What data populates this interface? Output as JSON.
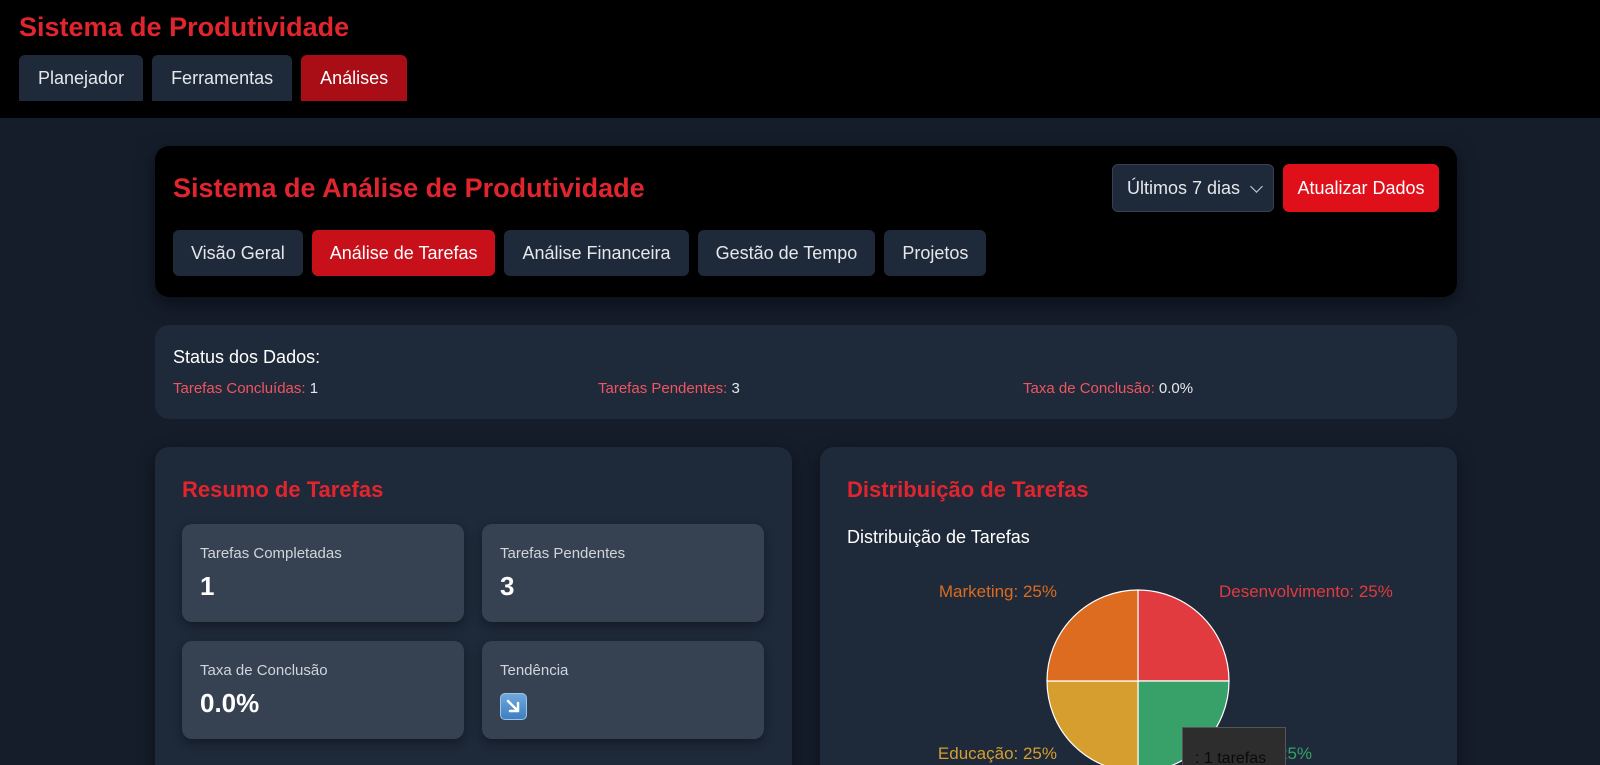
{
  "app": {
    "title": "Sistema de Produtividade",
    "tabs": [
      "Planejador",
      "Ferramentas",
      "Análises"
    ],
    "active_tab": "Análises"
  },
  "header": {
    "title": "Sistema de Análise de Produtividade",
    "period_select": "Últimos 7 dias",
    "refresh_label": "Atualizar Dados",
    "sub_tabs": [
      "Visão Geral",
      "Análise de Tarefas",
      "Análise Financeira",
      "Gestão de Tempo",
      "Projetos"
    ],
    "active_sub_tab": "Análise de Tarefas"
  },
  "status": {
    "title": "Status dos Dados:",
    "completed_label": "Tarefas Concluídas:",
    "completed_value": "1",
    "pending_label": "Tarefas Pendentes:",
    "pending_value": "3",
    "rate_label": "Taxa de Conclusão:",
    "rate_value": "0.0%"
  },
  "summary": {
    "title": "Resumo de Tarefas",
    "completed_label": "Tarefas Completadas",
    "completed_value": "1",
    "pending_label": "Tarefas Pendentes",
    "pending_value": "3",
    "rate_label": "Taxa de Conclusão",
    "rate_value": "0.0%",
    "trend_label": "Tendência",
    "trend_icon": "arrow-down-right-icon"
  },
  "distribution": {
    "title": "Distribuição de Tarefas",
    "tooltip": ": 1 tarefas",
    "colors": {
      "Desenvolvimento": "#e23b3f",
      "Saúde": "#38a169",
      "Educação": "#d69e2e",
      "Marketing": "#dd6b20"
    }
  },
  "chart_data": {
    "type": "pie",
    "title": "Distribuição de Tarefas",
    "categories": [
      "Desenvolvimento",
      "Saúde",
      "Educação",
      "Marketing"
    ],
    "values": [
      25,
      25,
      25,
      25
    ],
    "labels": [
      "Desenvolvimento: 25%",
      "25%",
      "Educação: 25%",
      "Marketing: 25%"
    ]
  }
}
